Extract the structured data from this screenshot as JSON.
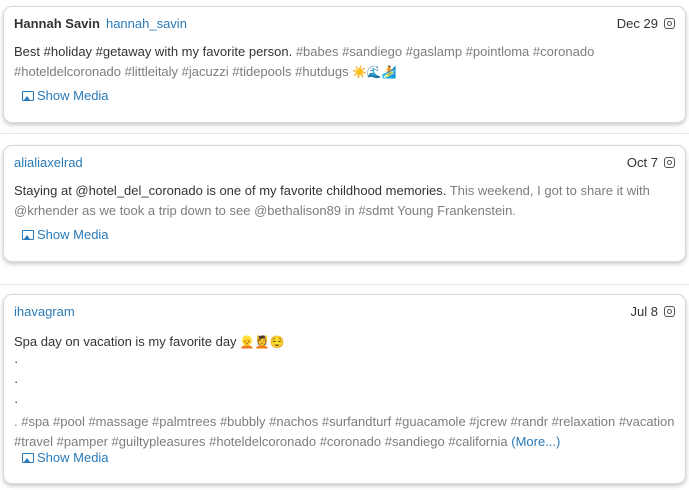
{
  "posts": [
    {
      "author": "Hannah Savin",
      "handle": "hannah_savin",
      "date": "Dec 29",
      "text_main": "Best #holiday #getaway with my favorite person.",
      "text_gray": " #babes #sandiego #gaslamp #pointloma #coronado",
      "text_line2": "#hoteldelcoronado #littleitaly #jacuzzi #tidepools #hutdugs",
      "emoji": " ☀️🌊🏄",
      "media_label": "Show Media"
    },
    {
      "handle": "alialiaxelrad",
      "date": "Oct 7",
      "text_main": "Staying at @hotel_del_coronado is one of my favorite childhood memories.",
      "text_gray": " This weekend, I got to share it with",
      "text_line2": "@krhender as we took a trip down to see @bethalison89 in #sdmt Young Frankenstein.",
      "media_label": "Show Media"
    },
    {
      "handle": "ihavagram",
      "date": "Jul 8",
      "text_main": "Spa day on vacation is my favorite day",
      "emoji": " 👱💆😌",
      "dots": [
        "·",
        "·",
        "·"
      ],
      "tags_line1": ". #spa #pool #massage #palmtrees #bubbly #nachos #surfandturf #guacamole #jcrew #randr #relaxation #vacation",
      "tags_line2": "#travel #pamper #guiltypleasures #hoteldelcoronado #coronado #sandiego #california",
      "more_label": "(More...)",
      "media_label": "Show Media"
    }
  ]
}
